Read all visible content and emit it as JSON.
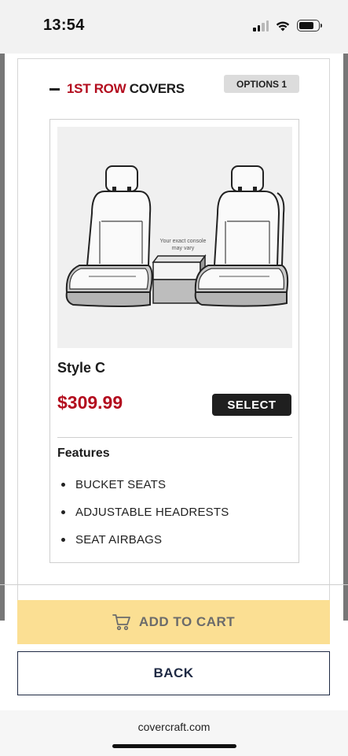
{
  "status_bar": {
    "time": "13:54"
  },
  "section": {
    "title_highlight": "1ST ROW",
    "title_rest": " COVERS",
    "options_badge": "OPTIONS 1"
  },
  "product": {
    "image_caption_line1": "Your exact console",
    "image_caption_line2": "may vary",
    "style_name": "Style C",
    "price": "$309.99",
    "select_label": "SELECT",
    "features_title": "Features",
    "features": [
      "BUCKET SEATS",
      "ADJUSTABLE HEADRESTS",
      "SEAT AIRBAGS"
    ]
  },
  "actions": {
    "add_to_cart_label": "ADD TO CART",
    "back_label": "BACK"
  },
  "browser": {
    "url": "covercraft.com"
  },
  "colors": {
    "brand_red": "#b30d1e",
    "cart_yellow": "#fbdf93",
    "navy": "#1f2a44"
  }
}
